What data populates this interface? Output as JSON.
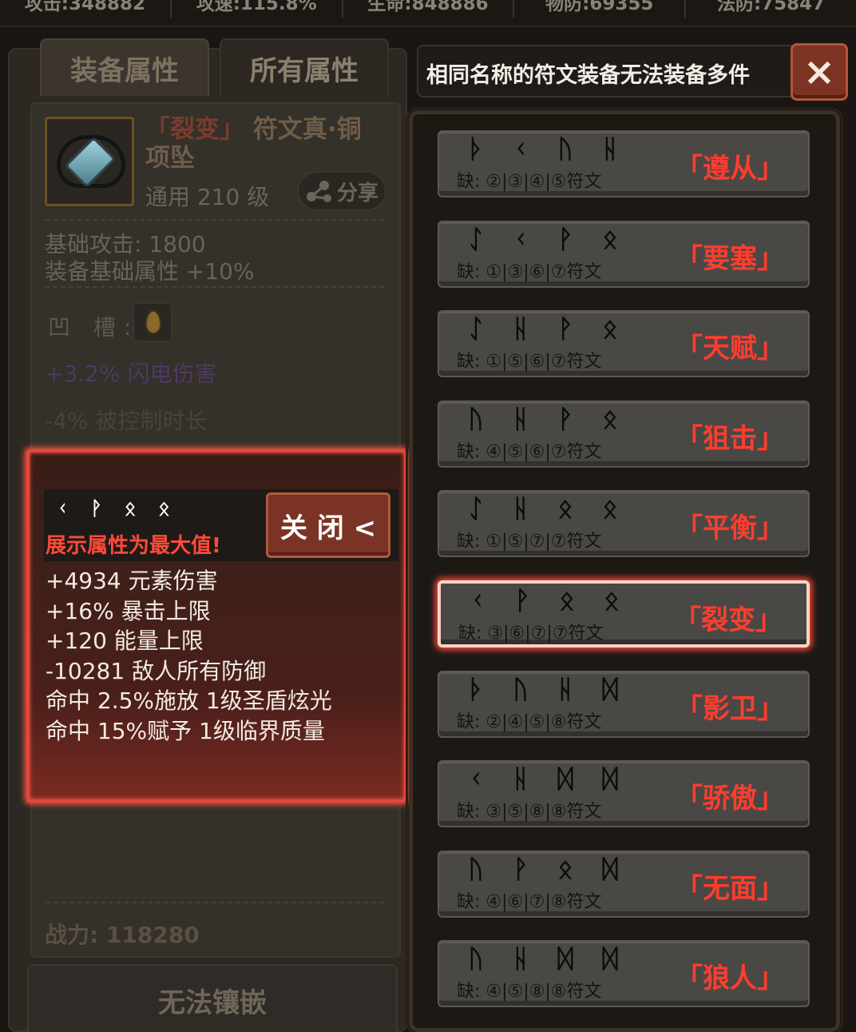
{
  "top_stats": [
    "攻击:348882",
    "攻速:115.8%",
    "生命:848886",
    "物防:69355",
    "法防:75847"
  ],
  "tabs": {
    "equip": "装备属性",
    "all": "所有属性"
  },
  "item": {
    "rune_prefix": "「裂变」",
    "name": "符文真·铜项坠",
    "level": "通用 210 级",
    "share": "分享",
    "base_attack": "基础攻击:  1800",
    "base_bonus": "装备基础属性 +10%",
    "socket_label": "凹  槽:",
    "purple_stat": "+3.2% 闪电伤害",
    "grey_stat": "-4% 被控制时长",
    "power": "战力:  118280",
    "action_button": "无法镶嵌"
  },
  "popup": {
    "runes": [
      "ᚲ",
      "ᚹ",
      "ᛟ",
      "ᛟ"
    ],
    "max_note": "展示属性为最大值!",
    "close": "关 闭 <",
    "lines": [
      "+4934 元素伤害",
      "+16% 暴击上限",
      "+120 能量上限",
      "-10281 敌人所有防御",
      "命中 2.5%施放 1级圣盾炫光",
      "命中 15%赋予 1级临界质量"
    ]
  },
  "notice": {
    "text": "相同名称的符文装备无法装备多件",
    "close": "×"
  },
  "rune_words": [
    {
      "glyphs": [
        "ᚦ",
        "ᚲ",
        "ᚢ",
        "ᚺ"
      ],
      "missing": "缺: ②|③|④|⑤符文",
      "name": "「遵从」",
      "selected": false
    },
    {
      "glyphs": [
        "ᛇ",
        "ᚲ",
        "ᚹ",
        "ᛟ"
      ],
      "missing": "缺: ①|③|⑥|⑦符文",
      "name": "「要塞」",
      "selected": false
    },
    {
      "glyphs": [
        "ᛇ",
        "ᚺ",
        "ᚹ",
        "ᛟ"
      ],
      "missing": "缺: ①|⑤|⑥|⑦符文",
      "name": "「天赋」",
      "selected": false
    },
    {
      "glyphs": [
        "ᚢ",
        "ᚺ",
        "ᚹ",
        "ᛟ"
      ],
      "missing": "缺: ④|⑤|⑥|⑦符文",
      "name": "「狙击」",
      "selected": false
    },
    {
      "glyphs": [
        "ᛇ",
        "ᚺ",
        "ᛟ",
        "ᛟ"
      ],
      "missing": "缺: ①|⑤|⑦|⑦符文",
      "name": "「平衡」",
      "selected": false
    },
    {
      "glyphs": [
        "ᚲ",
        "ᚹ",
        "ᛟ",
        "ᛟ"
      ],
      "missing": "缺: ③|⑥|⑦|⑦符文",
      "name": "「裂变」",
      "selected": true
    },
    {
      "glyphs": [
        "ᚦ",
        "ᚢ",
        "ᚺ",
        "ᛞ"
      ],
      "missing": "缺: ②|④|⑤|⑧符文",
      "name": "「影卫」",
      "selected": false
    },
    {
      "glyphs": [
        "ᚲ",
        "ᚺ",
        "ᛞ",
        "ᛞ"
      ],
      "missing": "缺: ③|⑤|⑧|⑧符文",
      "name": "「骄傲」",
      "selected": false
    },
    {
      "glyphs": [
        "ᚢ",
        "ᚹ",
        "ᛟ",
        "ᛞ"
      ],
      "missing": "缺: ④|⑥|⑦|⑧符文",
      "name": "「无面」",
      "selected": false
    },
    {
      "glyphs": [
        "ᚢ",
        "ᚺ",
        "ᛞ",
        "ᛞ"
      ],
      "missing": "缺: ④|⑤|⑧|⑧符文",
      "name": "「狼人」",
      "selected": false
    }
  ]
}
